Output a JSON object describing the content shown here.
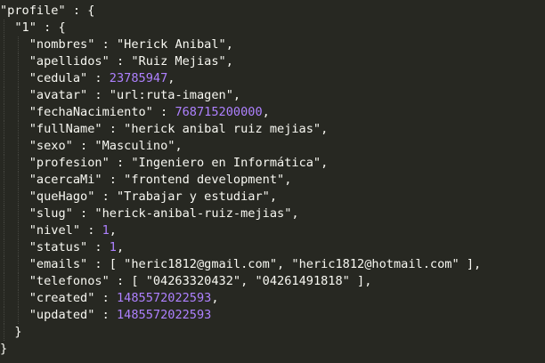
{
  "code": {
    "lines": [
      [
        {
          "t": "\"profile\"",
          "c": "key"
        },
        {
          "t": " : {",
          "c": "punc"
        }
      ],
      [
        {
          "t": "  \"1\"",
          "c": "key"
        },
        {
          "t": " : {",
          "c": "punc"
        }
      ],
      [
        {
          "t": "    \"nombres\"",
          "c": "key"
        },
        {
          "t": " : ",
          "c": "punc"
        },
        {
          "t": "\"Herick Anibal\"",
          "c": "str"
        },
        {
          "t": ",",
          "c": "punc"
        }
      ],
      [
        {
          "t": "    \"apellidos\"",
          "c": "key"
        },
        {
          "t": " : ",
          "c": "punc"
        },
        {
          "t": "\"Ruiz Mejias\"",
          "c": "str"
        },
        {
          "t": ",",
          "c": "punc"
        }
      ],
      [
        {
          "t": "    \"cedula\"",
          "c": "key"
        },
        {
          "t": " : ",
          "c": "punc"
        },
        {
          "t": "23785947",
          "c": "num"
        },
        {
          "t": ",",
          "c": "punc"
        }
      ],
      [
        {
          "t": "    \"avatar\"",
          "c": "key"
        },
        {
          "t": " : ",
          "c": "punc"
        },
        {
          "t": "\"url:ruta-imagen\"",
          "c": "str"
        },
        {
          "t": ",",
          "c": "punc"
        }
      ],
      [
        {
          "t": "    \"fechaNacimiento\"",
          "c": "key"
        },
        {
          "t": " : ",
          "c": "punc"
        },
        {
          "t": "768715200000",
          "c": "num"
        },
        {
          "t": ",",
          "c": "punc"
        }
      ],
      [
        {
          "t": "    \"fullName\"",
          "c": "key"
        },
        {
          "t": " : ",
          "c": "punc"
        },
        {
          "t": "\"herick anibal ruiz mejias\"",
          "c": "str"
        },
        {
          "t": ",",
          "c": "punc"
        }
      ],
      [
        {
          "t": "    \"sexo\"",
          "c": "key"
        },
        {
          "t": " : ",
          "c": "punc"
        },
        {
          "t": "\"Masculino\"",
          "c": "str"
        },
        {
          "t": ",",
          "c": "punc"
        }
      ],
      [
        {
          "t": "    \"profesion\"",
          "c": "key"
        },
        {
          "t": " : ",
          "c": "punc"
        },
        {
          "t": "\"Ingeniero en Informática\"",
          "c": "str"
        },
        {
          "t": ",",
          "c": "punc"
        }
      ],
      [
        {
          "t": "    \"acercaMi\"",
          "c": "key"
        },
        {
          "t": " : ",
          "c": "punc"
        },
        {
          "t": "\"frontend development\"",
          "c": "str"
        },
        {
          "t": ",",
          "c": "punc"
        }
      ],
      [
        {
          "t": "    \"queHago\"",
          "c": "key"
        },
        {
          "t": " : ",
          "c": "punc"
        },
        {
          "t": "\"Trabajar y estudiar\"",
          "c": "str"
        },
        {
          "t": ",",
          "c": "punc"
        }
      ],
      [
        {
          "t": "    \"slug\"",
          "c": "key"
        },
        {
          "t": " : ",
          "c": "punc"
        },
        {
          "t": "\"herick-anibal-ruiz-mejias\"",
          "c": "str"
        },
        {
          "t": ",",
          "c": "punc"
        }
      ],
      [
        {
          "t": "    \"nivel\"",
          "c": "key"
        },
        {
          "t": " : ",
          "c": "punc"
        },
        {
          "t": "1",
          "c": "num"
        },
        {
          "t": ",",
          "c": "punc"
        }
      ],
      [
        {
          "t": "    \"status\"",
          "c": "key"
        },
        {
          "t": " : ",
          "c": "punc"
        },
        {
          "t": "1",
          "c": "num"
        },
        {
          "t": ",",
          "c": "punc"
        }
      ],
      [
        {
          "t": "    \"emails\"",
          "c": "key"
        },
        {
          "t": " : [ ",
          "c": "punc"
        },
        {
          "t": "\"heric1812@gmail.com\"",
          "c": "str"
        },
        {
          "t": ", ",
          "c": "punc"
        },
        {
          "t": "\"heric1812@hotmail.com\"",
          "c": "str"
        },
        {
          "t": " ],",
          "c": "punc"
        }
      ],
      [
        {
          "t": "    \"telefonos\"",
          "c": "key"
        },
        {
          "t": " : [ ",
          "c": "punc"
        },
        {
          "t": "\"04263320432\"",
          "c": "str"
        },
        {
          "t": ", ",
          "c": "punc"
        },
        {
          "t": "\"04261491818\"",
          "c": "str"
        },
        {
          "t": " ],",
          "c": "punc"
        }
      ],
      [
        {
          "t": "    \"created\"",
          "c": "key"
        },
        {
          "t": " : ",
          "c": "punc"
        },
        {
          "t": "1485572022593",
          "c": "num"
        },
        {
          "t": ",",
          "c": "punc"
        }
      ],
      [
        {
          "t": "    \"updated\"",
          "c": "key"
        },
        {
          "t": " : ",
          "c": "punc"
        },
        {
          "t": "1485572022593",
          "c": "num"
        }
      ],
      [
        {
          "t": "  }",
          "c": "punc"
        }
      ],
      [
        {
          "t": "}",
          "c": "punc"
        }
      ]
    ]
  },
  "colors": {
    "background": "#272822",
    "text": "#f8f8f2",
    "number": "#ae81ff",
    "indent_guide": "#464741"
  }
}
